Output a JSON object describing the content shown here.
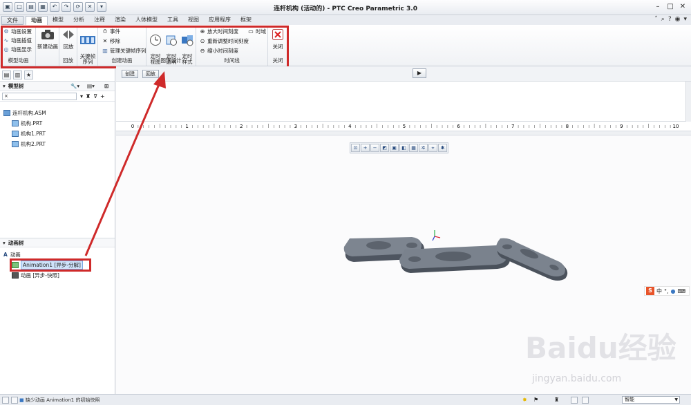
{
  "window": {
    "title": "连杆机构 (活动的) - PTC Creo Parametric 3.0"
  },
  "tabs": [
    "文件",
    "动画",
    "模型",
    "分析",
    "注释",
    "渲染",
    "人体模型",
    "工具",
    "视图",
    "应用程序",
    "框架"
  ],
  "ribbon": {
    "model_anim": {
      "items": [
        "动画设置",
        "动画插值",
        "动画显示"
      ],
      "label": "模型动画"
    },
    "new_anim": "新建动画",
    "playback": {
      "button": "回放",
      "label": "回放"
    },
    "keyframe_seq": "关键帧\n序列",
    "create_anim": {
      "items": [
        "事件",
        "移除",
        "管理关键帧序列"
      ],
      "label": "创建动画"
    },
    "graphic": {
      "buttons": [
        "定时\n视图",
        "定时\n透明",
        "定时\n样式"
      ],
      "label": "图形设计"
    },
    "timeline": {
      "items": [
        "放大时间刻度",
        "重新调整时间刻度",
        "缩小时间刻度"
      ],
      "time_domain": "时域",
      "label": "时间线"
    },
    "close": {
      "button": "关闭",
      "label": "关闭"
    }
  },
  "left": {
    "model_tree_title": "模型树",
    "model_tree": [
      "连杆机构.ASM",
      "机构.PRT",
      "机构1.PRT",
      "机构2.PRT"
    ],
    "anim_tree_title": "动画树",
    "anim_tree": [
      "动画",
      "Animation1 [异步-分解]",
      "动画 [异步-快照]"
    ]
  },
  "timeline": {
    "create_label": "创建",
    "playback_label": "回放",
    "ruler": [
      "0",
      "1",
      "2",
      "3",
      "4",
      "5",
      "6",
      "7",
      "8",
      "9",
      "10"
    ]
  },
  "ime": {
    "logo": "S",
    "text": "中"
  },
  "status": {
    "message": "缺少动画 Animation1 的初始快照",
    "filter": "智能"
  },
  "watermark": {
    "brand": "Baidu经验",
    "url": "jingyan.baidu.com"
  },
  "colors": {
    "highlight_red": "#cf2a2a",
    "selection": "#cfe3fb"
  }
}
